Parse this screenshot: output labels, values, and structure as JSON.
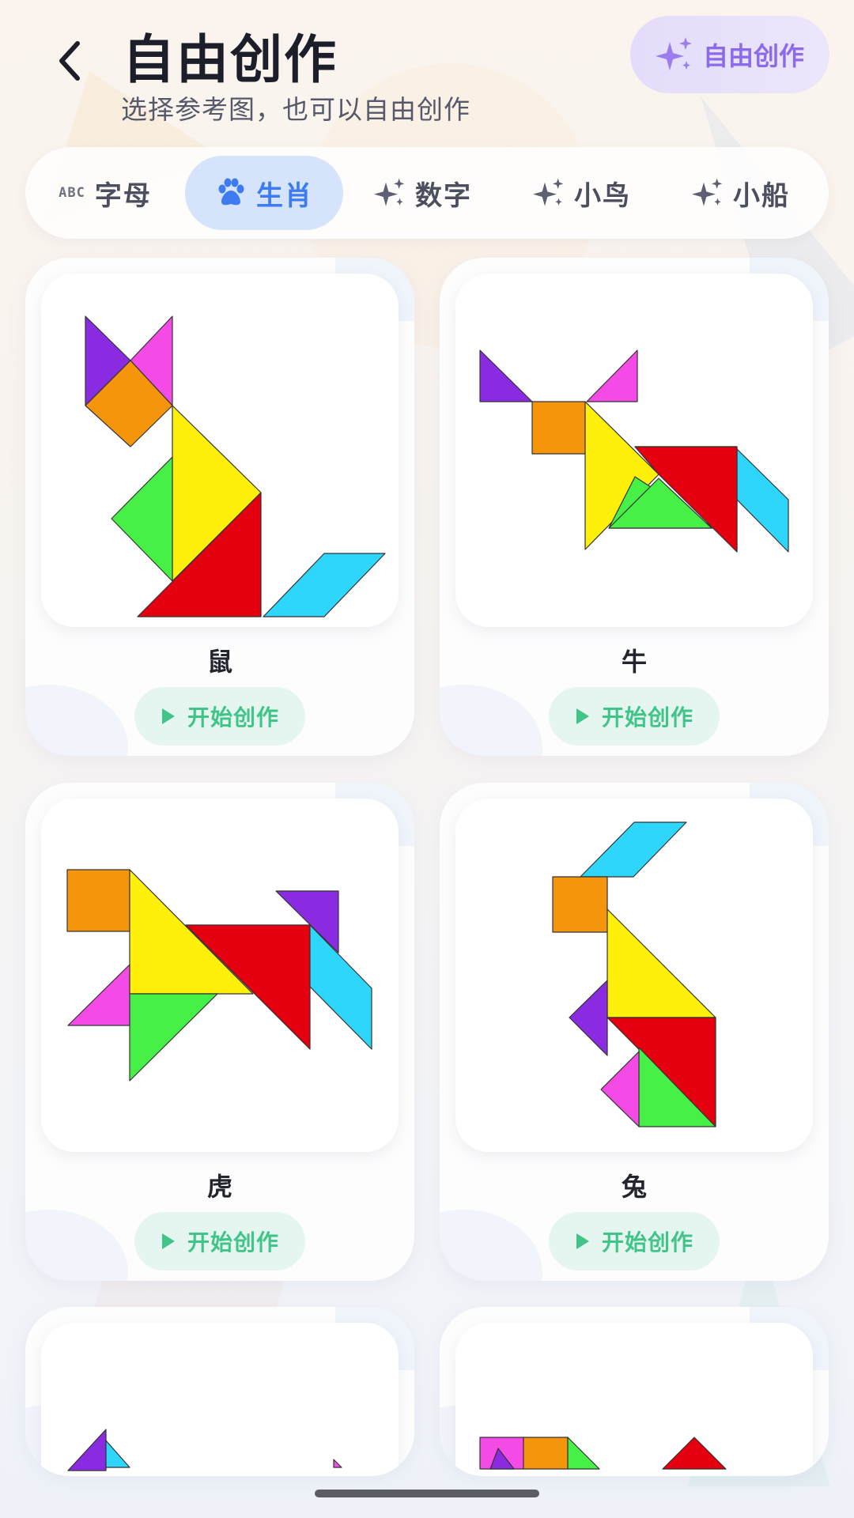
{
  "header": {
    "title": "自由创作",
    "subtitle": "选择参考图，也可以自由创作",
    "free_button_label": "自由创作"
  },
  "tabs": [
    {
      "label": "字母",
      "icon": "abc-icon",
      "icon_text": "ABC",
      "active": false
    },
    {
      "label": "生肖",
      "icon": "paw-icon",
      "active": true
    },
    {
      "label": "数字",
      "icon": "sparkle-icon",
      "active": false
    },
    {
      "label": "小鸟",
      "icon": "sparkle-icon",
      "active": false
    },
    {
      "label": "小船",
      "icon": "sparkle-icon",
      "active": false
    }
  ],
  "cards": [
    {
      "name": "鼠",
      "button_label": "开始创作"
    },
    {
      "name": "牛",
      "button_label": "开始创作"
    },
    {
      "name": "虎",
      "button_label": "开始创作"
    },
    {
      "name": "兔",
      "button_label": "开始创作"
    }
  ],
  "colors": {
    "accent_blue": "#3c7bf2",
    "accent_purple": "#8b6bea",
    "start_green": "#41c487",
    "tangram_purple": "#8a2be2",
    "tangram_pink": "#f44ae6",
    "tangram_orange": "#f5950c",
    "tangram_yellow": "#fef00a",
    "tangram_green": "#46f046",
    "tangram_red": "#e5000f",
    "tangram_cyan": "#2ed6fb"
  }
}
